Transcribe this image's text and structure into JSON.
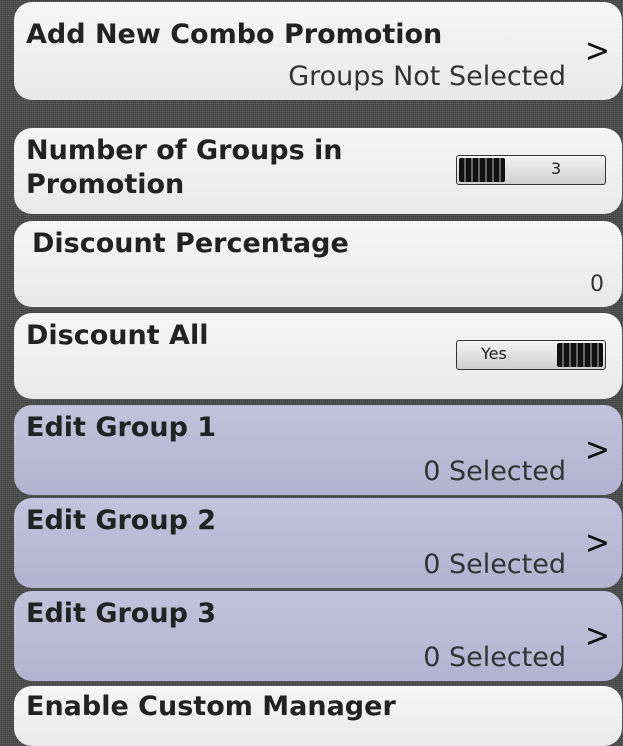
{
  "rows": [
    {
      "title": "Add New Combo Promotion",
      "sub": "Groups Not Selected",
      "chevron": ">"
    },
    {
      "title_line1": "Number of Groups in",
      "title_line2": "Promotion",
      "slider_value": "3"
    },
    {
      "title": "Discount Percentage",
      "value": "0"
    },
    {
      "title": "Discount All",
      "toggle_label": "Yes"
    },
    {
      "title": "Edit Group 1",
      "sub": "0 Selected",
      "chevron": ">"
    },
    {
      "title": "Edit Group 2",
      "sub": "0 Selected",
      "chevron": ">"
    },
    {
      "title": "Edit Group 3",
      "sub": "0 Selected",
      "chevron": ">"
    },
    {
      "title": "Enable Custom Manager"
    }
  ]
}
